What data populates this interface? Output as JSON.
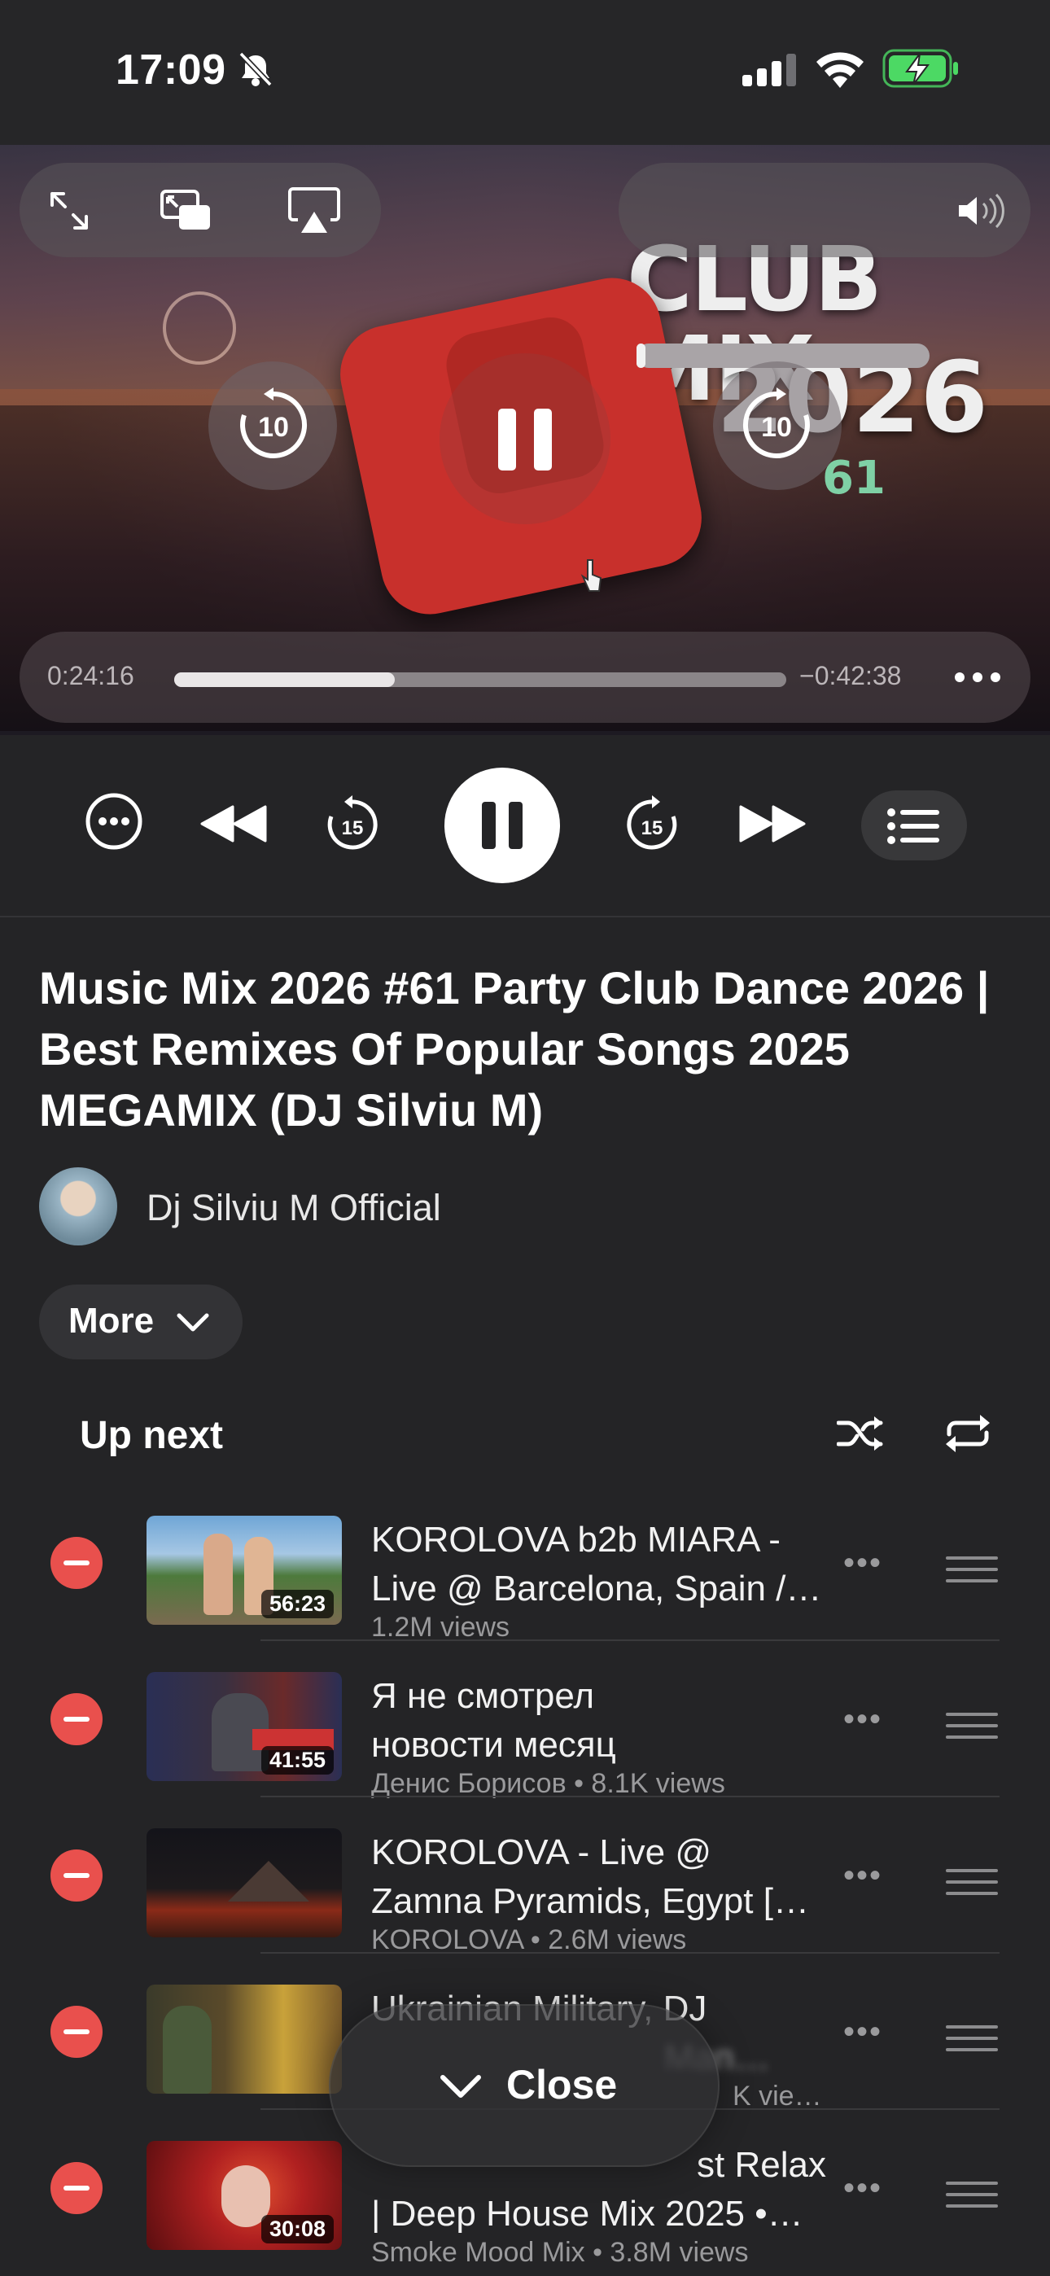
{
  "status_bar": {
    "time": "17:09",
    "icons": [
      "bell-slash-icon",
      "cellular-signal-icon",
      "wifi-icon",
      "battery-charging-icon"
    ]
  },
  "video": {
    "overlay_text": {
      "line1": "CLUB MIX",
      "line2": "2026",
      "line3": "61"
    },
    "elapsed": "0:24:16",
    "remaining": "−0:42:38",
    "progress": 0.36,
    "volume": 0.03,
    "skip_back": "10",
    "skip_forward": "10"
  },
  "transport": {
    "skip_back_seconds": "15",
    "skip_forward_seconds": "15"
  },
  "now_playing": {
    "title": "Music Mix 2026 #61 Party Club Dance 2026 | Best Remixes Of Popular Songs 2025 MEGAMIX (DJ Silviu M)",
    "channel": "Dj Silviu M Official",
    "more_label": "More"
  },
  "up_next": {
    "heading": "Up next",
    "items": [
      {
        "title_line1": "KOROLOVA b2b MIARA -",
        "title_line2": "Live @ Barcelona, Spain /…",
        "subtitle": "1.2M views",
        "duration": "56:23"
      },
      {
        "title_line1": "Я не смотрел",
        "title_line2": "новости месяц",
        "subtitle": "Денис Борисов • 8.1K views",
        "duration": "41:55"
      },
      {
        "title_line1": "KOROLOVA - Live @",
        "title_line2": "Zamna Pyramids, Egypt […",
        "subtitle": "KOROLOVA • 2.6M views",
        "duration": ""
      },
      {
        "title_line1": "Ukrainian Military, DJ",
        "title_line2": "Man…",
        "subtitle": "K vie…",
        "duration": ""
      },
      {
        "title_line1": "st Relax",
        "title_line2": "| Deep House Mix 2025 •…",
        "subtitle": "Smoke Mood Mix • 3.8M views",
        "duration": "30:08"
      }
    ]
  },
  "close_button": {
    "label": "Close"
  },
  "colors": {
    "background": "#242426",
    "remove": "#e9504d",
    "accent_logo": "#c8302c",
    "battery": "#4cd964"
  }
}
